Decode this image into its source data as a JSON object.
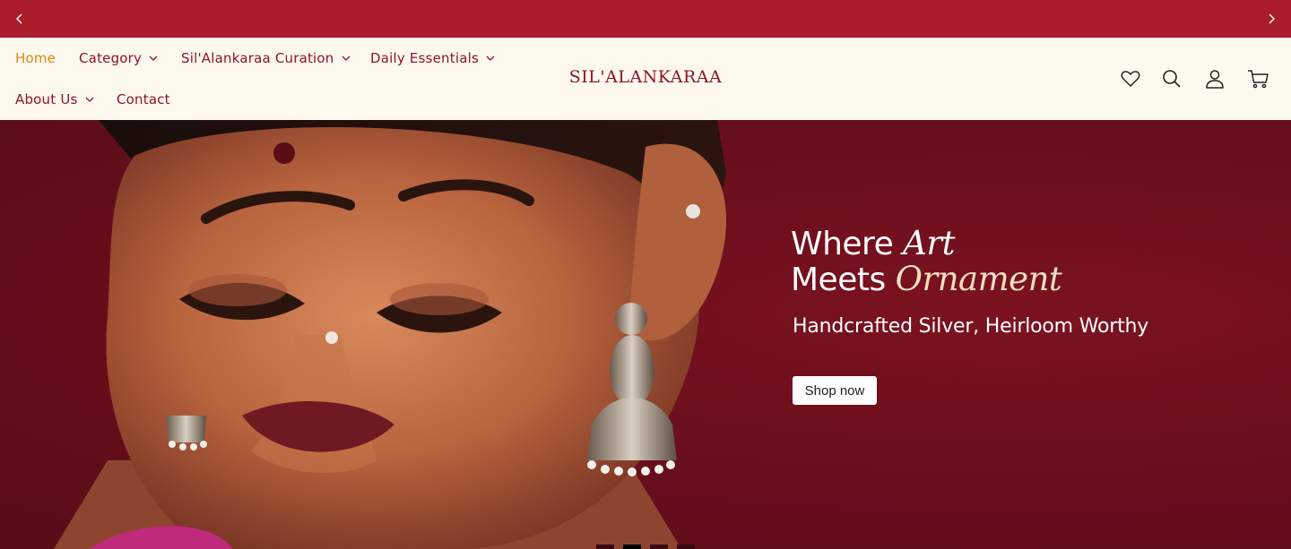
{
  "announcement": {
    "prev_icon": "chevron-left-icon",
    "next_icon": "chevron-right-icon",
    "color": "#ab1c2e"
  },
  "nav": {
    "items": [
      {
        "label": "Home",
        "active": true,
        "dropdown": false
      },
      {
        "label": "Category",
        "active": false,
        "dropdown": true
      },
      {
        "label": "Sil'Alankaraa Curation",
        "active": false,
        "dropdown": true
      },
      {
        "label": "Daily Essentials",
        "active": false,
        "dropdown": true
      },
      {
        "label": "About Us",
        "active": false,
        "dropdown": true
      },
      {
        "label": "Contact",
        "active": false,
        "dropdown": false
      }
    ],
    "active_color": "#d98a14",
    "text_color": "#8c1526"
  },
  "brand": {
    "logo_text": "SIL'ALANKARAA"
  },
  "header_icons": [
    "heart-icon",
    "search-icon",
    "account-icon",
    "cart-icon"
  ],
  "hero": {
    "headline_line1_a": "Where ",
    "headline_line1_b": "Art",
    "headline_line2_a": "Meets ",
    "headline_line2_b": "Ornament",
    "subheading": "Handcrafted Silver, Heirloom Worthy",
    "cta_label": "Shop now",
    "slides": 4,
    "active_slide": 2,
    "background_color": "#6a0f1c"
  }
}
